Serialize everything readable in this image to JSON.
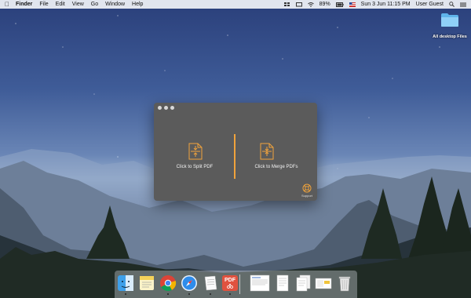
{
  "menubar": {
    "apple_icon": "apple-icon",
    "app_name": "Finder",
    "items": [
      "File",
      "Edit",
      "View",
      "Go",
      "Window",
      "Help"
    ],
    "battery": "89%",
    "datetime": "Sun 3 Jun  11:15 PM",
    "user": "User Guest"
  },
  "desktop": {
    "folder_label": "All desktop Files"
  },
  "app": {
    "split_label": "Click to Split PDF",
    "merge_label": "Click to Merge PDFs",
    "support_label": "Support",
    "accent_color": "#f0a33c"
  },
  "dock": {
    "items": [
      "finder",
      "notes",
      "chrome",
      "safari",
      "text-document",
      "pdf-app",
      "document-preview",
      "document",
      "document-stack",
      "document-pages",
      "trash"
    ],
    "pdf_badge": "PDF"
  }
}
